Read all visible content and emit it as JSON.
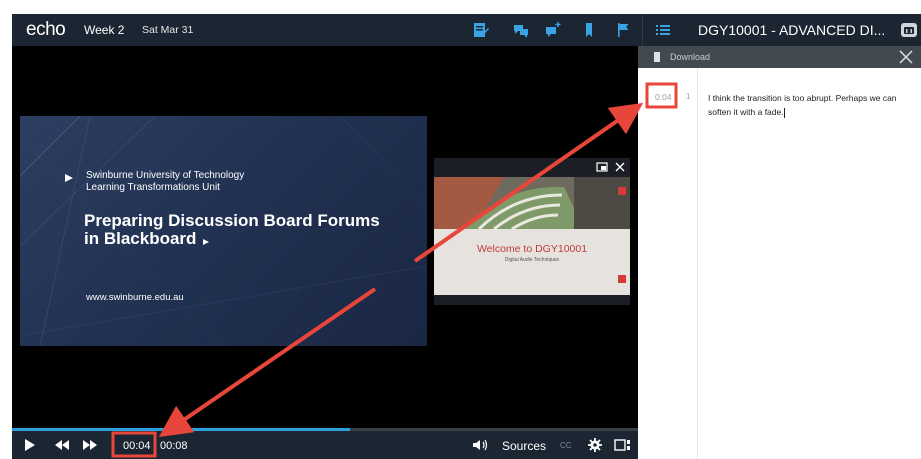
{
  "header": {
    "logo": "echo",
    "week": "Week 2",
    "date": "Sat Mar 31",
    "course_title": "DGY10001 - ADVANCED DI...",
    "icons": [
      "notes-icon",
      "discussion-icon",
      "add-question-icon",
      "bookmark-icon",
      "flag-icon",
      "list-icon",
      "print-icon"
    ],
    "icon_color": "#3aa3e3"
  },
  "slide": {
    "university": "Swinburne University of Technology",
    "unit": "Learning Transformations Unit",
    "title_line1": "Preparing Discussion Board Forums",
    "title_line2": "in Blackboard",
    "url": "www.swinburne.edu.au"
  },
  "pip": {
    "welcome": "Welcome to DGY10001",
    "subtitle": "Digital Audio Techniques",
    "icons": [
      "popout-icon",
      "close-icon"
    ]
  },
  "player": {
    "current_time": "00:04",
    "total_time": "00:08",
    "progress": 0.54,
    "sources_label": "Sources",
    "cc_label": "CC",
    "progress_color": "#2d9fdc"
  },
  "notes_panel": {
    "download_label": "Download",
    "note": {
      "timestamp": "0:04",
      "number": "1",
      "text": "I think the transition is too abrupt.  Perhaps we can soften it with a fade."
    }
  },
  "annotation": {
    "highlight_color": "#e8463a"
  }
}
